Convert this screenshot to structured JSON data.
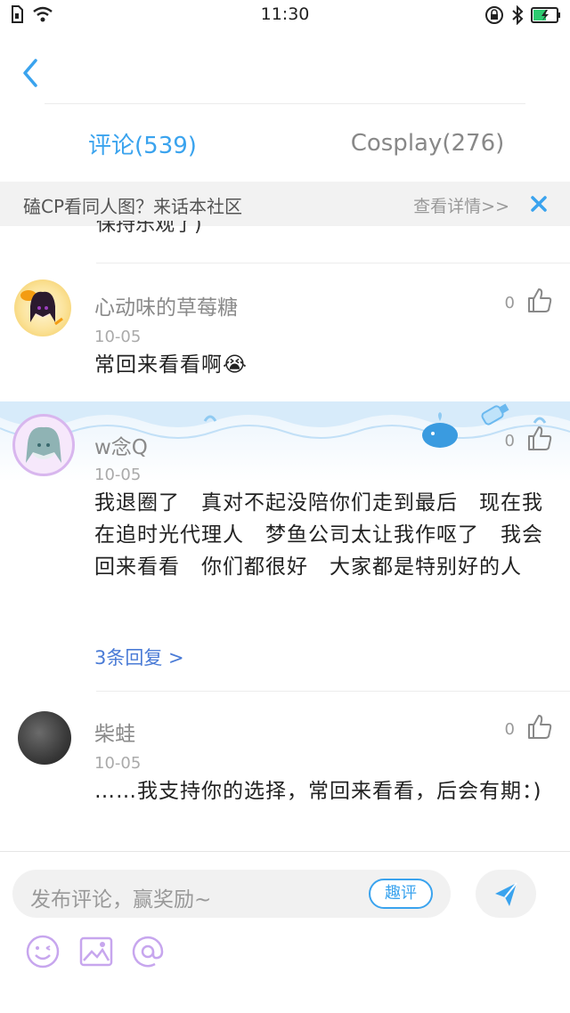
{
  "status_bar": {
    "time": "11:30"
  },
  "nav": {
    "back_label": ""
  },
  "tabs": [
    {
      "label": "评论(539)",
      "active": true
    },
    {
      "label": "Cosplay(276)",
      "active": false
    }
  ],
  "promo": {
    "text": "磕CP看同人图？来话本社区",
    "link": "查看详情>>"
  },
  "partial_comment": "保持乐观了)",
  "comments": [
    {
      "username": "心动味的草莓糖",
      "date": "10-05",
      "content": "常回来看看啊😭",
      "likes": "0"
    },
    {
      "username": "w念Q",
      "date": "10-05",
      "content": "我退圈了　真对不起没陪你们走到最后　现在我在追时光代理人　梦鱼公司太让我作呕了　我会回来看看　你们都很好　大家都是特别好的人",
      "likes": "0",
      "replies": "3条回复 >"
    },
    {
      "username": "柴蛙",
      "date": "10-05",
      "content": "……我支持你的选择，常回来看看，后会有期：)",
      "likes": "0"
    }
  ],
  "composer": {
    "placeholder": "发布评论，赢奖励~",
    "quiping_label": "趣评"
  },
  "colors": {
    "accent": "#3aa3ee",
    "link": "#4a7bd6"
  }
}
